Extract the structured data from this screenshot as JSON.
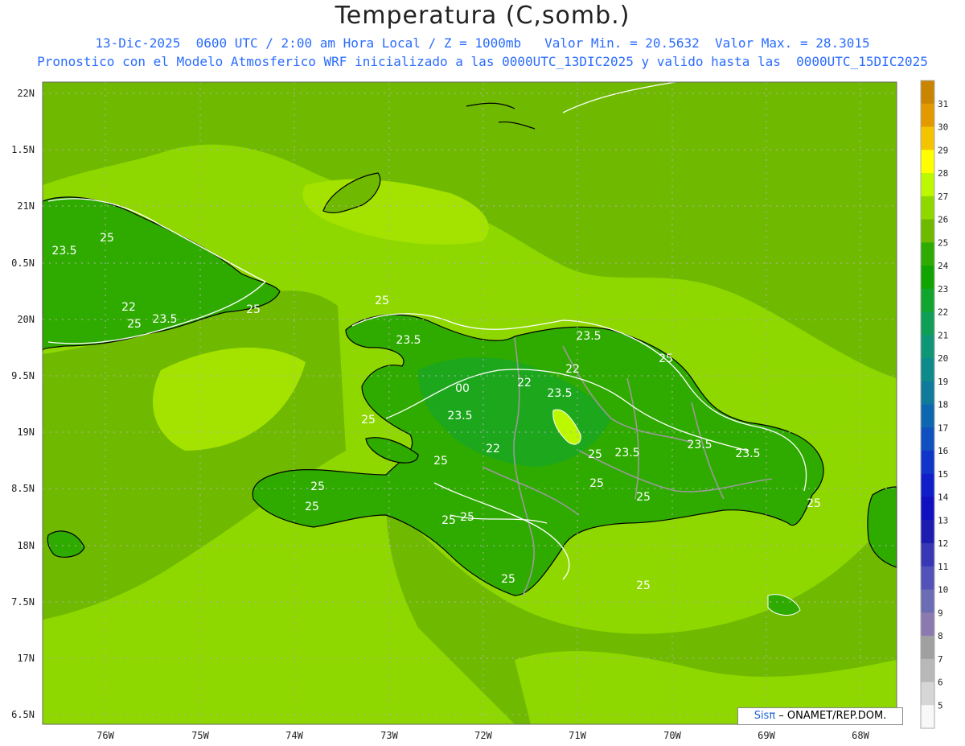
{
  "title": "Temperatura (C,somb.)",
  "subtitle_line1": "13-Dic-2025  0600 UTC / 2:00 am Hora Local / Z = 1000mb   Valor Min. = 20.5632  Valor Max. = 28.3015",
  "subtitle_line2": "Pronostico con el Modelo Atmosferico WRF inicializado a las 0000UTC_13DIC2025 y valido hasta las  0000UTC_15DIC2025",
  "credit": {
    "brand": "Sisπ",
    "text": " – ONAMET/REP.DOM."
  },
  "axes": {
    "lat_labels": [
      "22N",
      "1.5N",
      "21N",
      "0.5N",
      "20N",
      "9.5N",
      "19N",
      "8.5N",
      "18N",
      "7.5N",
      "17N",
      "6.5N"
    ],
    "lon_labels": [
      "76W",
      "75W",
      "74W",
      "73W",
      "72W",
      "71W",
      "70W",
      "69W",
      "68W"
    ]
  },
  "colorbar": {
    "labels": [
      "31",
      "30",
      "29",
      "28",
      "27",
      "26",
      "25",
      "24",
      "23",
      "22",
      "21",
      "20",
      "19",
      "18",
      "17",
      "16",
      "15",
      "14",
      "13",
      "12",
      "11",
      "10",
      "9",
      "8",
      "7",
      "6",
      "5"
    ],
    "colors": [
      "#c98400",
      "#e29a00",
      "#f5c400",
      "#ffff00",
      "#bcf800",
      "#8ed800",
      "#6fba00",
      "#2fab00",
      "#11a400",
      "#11a52f",
      "#0f9e56",
      "#0f9675",
      "#0f8a8a",
      "#0f7a9a",
      "#0f66b0",
      "#0f4fc0",
      "#0f36c8",
      "#0f1ec8",
      "#1010c0",
      "#1c1cb0",
      "#3838b4",
      "#5252b8",
      "#6c6cb4",
      "#8a7ab0",
      "#a0a0a0",
      "#b8b8b8",
      "#d6d6d6",
      "#f8f8f8"
    ]
  },
  "contour_labels": [
    {
      "text": "25"
    },
    {
      "text": "23.5"
    },
    {
      "text": "22"
    },
    {
      "text": "25"
    },
    {
      "text": "23.5"
    },
    {
      "text": "25"
    },
    {
      "text": "25"
    },
    {
      "text": "23.5"
    },
    {
      "text": "23.5"
    },
    {
      "text": "22"
    },
    {
      "text": "22"
    },
    {
      "text": "00"
    },
    {
      "text": "23.5"
    },
    {
      "text": "25"
    },
    {
      "text": "25"
    },
    {
      "text": "23.5"
    },
    {
      "text": "22"
    },
    {
      "text": "25"
    },
    {
      "text": "23.5"
    },
    {
      "text": "25"
    },
    {
      "text": "23.5"
    },
    {
      "text": "23.5"
    },
    {
      "text": "25"
    },
    {
      "text": "25"
    },
    {
      "text": "25"
    },
    {
      "text": "25"
    },
    {
      "text": "25"
    },
    {
      "text": "25"
    },
    {
      "text": "25"
    },
    {
      "text": "25"
    },
    {
      "text": "25"
    }
  ]
}
